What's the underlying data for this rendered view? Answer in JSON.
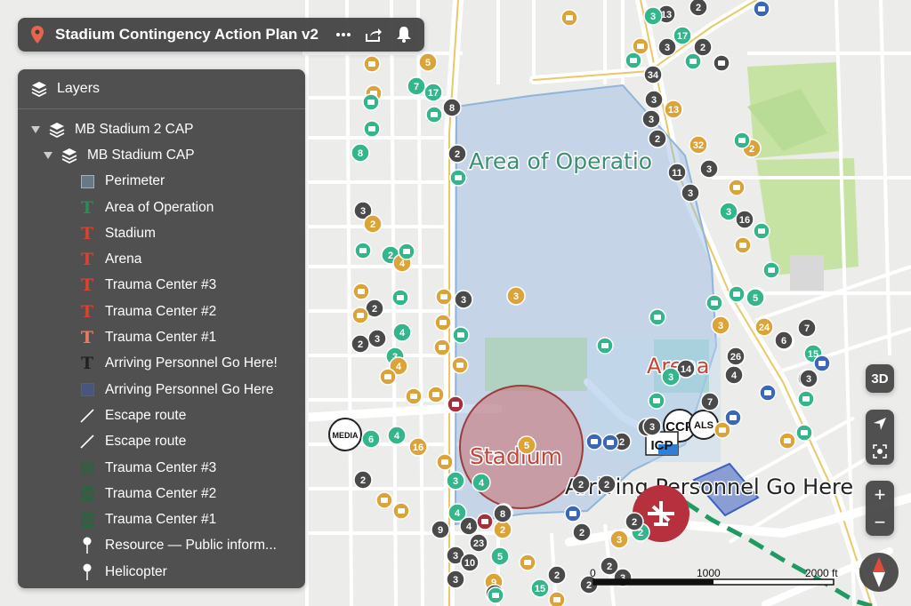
{
  "header": {
    "title": "Stadium Contingency Action Plan v2",
    "more_icon": "more-dots-icon",
    "share_icon": "share-icon",
    "bell_icon": "bell-icon"
  },
  "layers_panel": {
    "title": "Layers",
    "items": [
      {
        "label": "MB Stadium 2 CAP",
        "kind": "group",
        "level": 0
      },
      {
        "label": "MB Stadium CAP",
        "kind": "group",
        "level": 1
      },
      {
        "label": "Perimeter",
        "kind": "polygon",
        "color": "#8fb5da",
        "level": 2
      },
      {
        "label": "Area of Operation",
        "kind": "text",
        "color": "#2e8b57",
        "level": 2
      },
      {
        "label": "Stadium",
        "kind": "text",
        "color": "#d9432f",
        "level": 2
      },
      {
        "label": "Arena",
        "kind": "text",
        "color": "#d9432f",
        "level": 2
      },
      {
        "label": "Trauma Center #3",
        "kind": "text",
        "color": "#d9432f",
        "level": 2
      },
      {
        "label": "Trauma Center #2",
        "kind": "text",
        "color": "#d9432f",
        "level": 2
      },
      {
        "label": "Trauma Center #1",
        "kind": "text",
        "color": "#f07a5a",
        "level": 2
      },
      {
        "label": "Arriving Personnel Go Here!",
        "kind": "text",
        "color": "#222222",
        "level": 2
      },
      {
        "label": "Arriving Personnel Go Here",
        "kind": "polygon",
        "color": "#3b5fc0",
        "level": 2
      },
      {
        "label": "Escape route",
        "kind": "line",
        "color": "#ffffff",
        "level": 2
      },
      {
        "label": "Escape route",
        "kind": "line",
        "color": "#ffffff",
        "level": 2
      },
      {
        "label": "Trauma Center #3",
        "kind": "polygon",
        "color": "#1d6b3a",
        "level": 2
      },
      {
        "label": "Trauma Center #2",
        "kind": "polygon",
        "color": "#1d6b3a",
        "level": 2
      },
      {
        "label": "Trauma Center #1",
        "kind": "polygon",
        "color": "#1d6b3a",
        "level": 2
      },
      {
        "label": "Resource — Public inform...",
        "kind": "pin",
        "color": "#ffffff",
        "level": 2
      },
      {
        "label": "Helicopter",
        "kind": "pin",
        "color": "#ffffff",
        "level": 2
      }
    ]
  },
  "map_labels": {
    "area_of_operation": "Area of Operatio",
    "arena": "Arena",
    "stadium": "Stadium",
    "arriving": "Arriving Personnel Go Here",
    "media": "MEDIA",
    "ccp": "CCP",
    "icp": "ICP",
    "als": "ALS"
  },
  "markers": {
    "numbers": [
      "13",
      "3",
      "2",
      "17",
      "3",
      "2",
      "5",
      "7",
      "17",
      "8",
      "34",
      "3",
      "3",
      "13",
      "2",
      "8",
      "2",
      "32",
      "3",
      "11",
      "3",
      "3",
      "16",
      "2",
      "3",
      "2",
      "5",
      "2",
      "4",
      "3",
      "4",
      "2",
      "2",
      "3",
      "3",
      "3",
      "26",
      "4",
      "14",
      "3",
      "7",
      "3",
      "3",
      "10",
      "15",
      "6",
      "4",
      "16",
      "5",
      "4",
      "3",
      "2",
      "8",
      "4",
      "9",
      "23",
      "3",
      "10",
      "2",
      "5",
      "2",
      "2",
      "2",
      "3",
      "9",
      "13",
      "15",
      "2",
      "2",
      "3",
      "3",
      "7",
      "4",
      "6",
      "24",
      "2",
      "2",
      "2",
      "3",
      "4",
      "5",
      "2",
      "3",
      "8",
      "3"
    ],
    "colors": {
      "gold": "#dba43a",
      "dark": "#4a4a4a",
      "teal": "#35b58c",
      "red": "#a4303d",
      "blue": "#3a67b8",
      "green": "#2ea36c"
    }
  },
  "controls": {
    "btn_3d": "3D",
    "zoom_in": "+",
    "zoom_out": "−",
    "locate_icon": "navigation-arrow-icon",
    "fit_icon": "focus-frame-icon",
    "compass_icon": "compass-icon"
  },
  "scale_bar": {
    "tick_0": "0",
    "tick_1": "1000",
    "tick_2": "2000 ft"
  }
}
